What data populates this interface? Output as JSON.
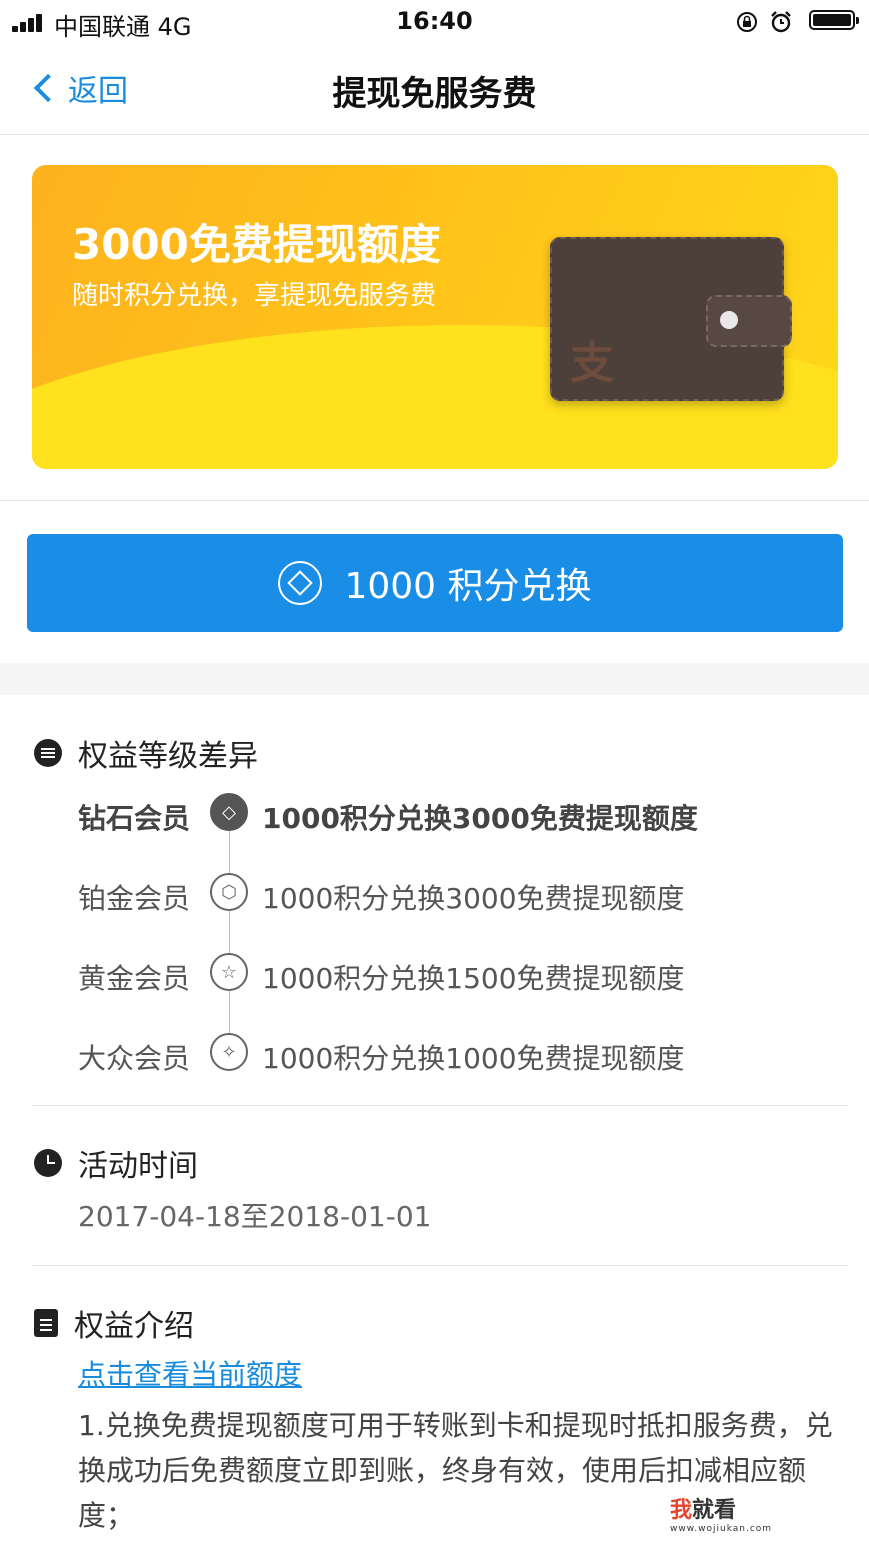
{
  "status_bar": {
    "carrier": "中国联通  4G",
    "time": "16:40"
  },
  "nav": {
    "back_label": "返回",
    "title": "提现免服务费"
  },
  "banner": {
    "headline": "3000免费提现额度",
    "subline": "随时积分兑换，享提现免服务费",
    "wallet_glyph": "支"
  },
  "redeem_button": {
    "label": "1000 积分兑换"
  },
  "levels_section": {
    "title": "权益等级差异",
    "levels": [
      {
        "name": "钻石会员",
        "desc": "1000积分兑换3000免费提现额度",
        "icon": "diamond-icon",
        "active": true
      },
      {
        "name": "铂金会员",
        "desc": "1000积分兑换3000免费提现额度",
        "icon": "platinum-hexagon-icon",
        "active": false
      },
      {
        "name": "黄金会员",
        "desc": "1000积分兑换1500免费提现额度",
        "icon": "gold-star-icon",
        "active": false
      },
      {
        "name": "大众会员",
        "desc": "1000积分兑换1000免费提现额度",
        "icon": "public-sparkle-icon",
        "active": false
      }
    ]
  },
  "time_section": {
    "title": "活动时间",
    "range": "2017-04-18至2018-01-01"
  },
  "intro_section": {
    "title": "权益介绍",
    "link": "点击查看当前额度",
    "paragraph": "1.兑换免费提现额度可用于转账到卡和提现时抵扣服务费，兑换成功后免费额度立即到账，终身有效，使用后扣减相应额度；"
  },
  "watermark": {
    "brand_red": "我",
    "brand_rest": "就看",
    "url": "www.wojiukan.com"
  },
  "colors": {
    "accent": "#1a8ee6",
    "banner_start": "#fdb21e",
    "banner_end": "#ffd81a"
  }
}
